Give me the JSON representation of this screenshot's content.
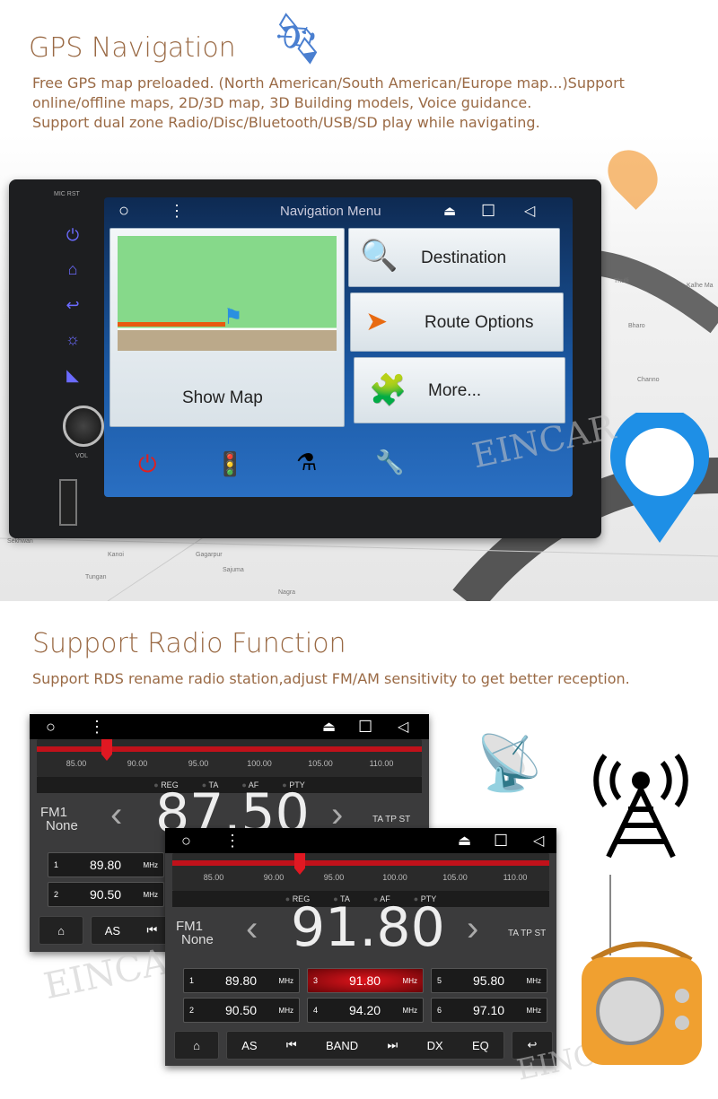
{
  "gps": {
    "title": "GPS Navigation",
    "lines": [
      "Free GPS map preloaded. (North American/South American/Europe map...)Support",
      "online/offline maps, 2D/3D map, 3D Building models, Voice guidance.",
      "Support dual zone Radio/Disc/Bluetooth/USB/SD play while navigating."
    ],
    "map_labels": [
      "Sekhwan",
      "Kanoi",
      "Gagarpur",
      "Sajuma",
      "Nagra",
      "Tungan",
      "Bharo",
      "Thulli",
      "Kalhe Ma",
      "Channo"
    ],
    "device": {
      "top_labels": "MIC  RST",
      "vol_label": "VOL",
      "side_icons": [
        "power-icon",
        "home-icon",
        "back-icon",
        "brightness-icon",
        "navigation-icon"
      ],
      "screen": {
        "title": "Navigation Menu",
        "tiles": [
          "Show Map",
          "Destination",
          "Route Options",
          "More..."
        ],
        "bottom_icons": [
          "power-icon",
          "traffic-info-icon",
          "flask-icon",
          "tools-icon"
        ]
      }
    },
    "watermark": "EINCAR"
  },
  "radio": {
    "title": "Support Radio Function",
    "desc": "Support RDS rename radio station,adjust FM/AM sensitivity to get better reception.",
    "scale": [
      "85.00",
      "90.00",
      "95.00",
      "100.00",
      "105.00",
      "110.00"
    ],
    "flags": [
      "REG",
      "TA",
      "AF",
      "PTY"
    ],
    "band": "FM1",
    "station": "None",
    "indicators": "TA TP ST",
    "back": {
      "freq": "87.50",
      "presets": [
        {
          "n": "1",
          "f": "89.80",
          "u": "MHz"
        },
        {
          "n": "2",
          "f": "90.50",
          "u": "MHz"
        }
      ],
      "controls": [
        "AS"
      ]
    },
    "front": {
      "freq": "91.80",
      "presets": [
        {
          "n": "1",
          "f": "89.80",
          "u": "MHz"
        },
        {
          "n": "2",
          "f": "90.50",
          "u": "MHz"
        },
        {
          "n": "3",
          "f": "91.80",
          "u": "MHz",
          "active": true
        },
        {
          "n": "4",
          "f": "94.20",
          "u": "MHz"
        },
        {
          "n": "5",
          "f": "95.80",
          "u": "MHz"
        },
        {
          "n": "6",
          "f": "97.10",
          "u": "MHz"
        }
      ],
      "controls": [
        "AS",
        "BAND",
        "DX",
        "EQ"
      ]
    },
    "watermark": "EINCAR"
  },
  "colors": {
    "heading": "#9a6a45",
    "accent_red": "#c0111a",
    "pin_blue": "#1e8fe6"
  }
}
